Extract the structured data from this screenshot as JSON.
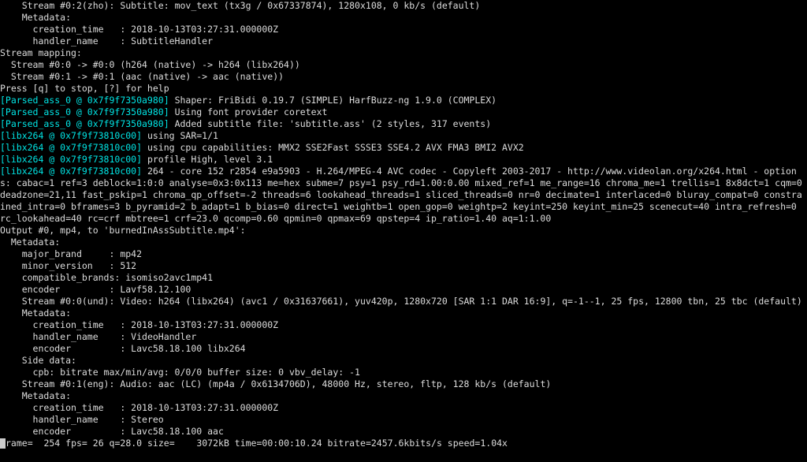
{
  "lines": [
    {
      "indent": "    ",
      "segments": [
        {
          "cls": "white",
          "text": "Stream #0:2(zho): Subtitle: mov_text (tx3g / 0x67337874), 1280x108, 0 kb/s (default)"
        }
      ]
    },
    {
      "indent": "    ",
      "segments": [
        {
          "cls": "white",
          "text": "Metadata:"
        }
      ]
    },
    {
      "indent": "      ",
      "segments": [
        {
          "cls": "white",
          "text": "creation_time   : 2018-10-13T03:27:31.000000Z"
        }
      ]
    },
    {
      "indent": "      ",
      "segments": [
        {
          "cls": "white",
          "text": "handler_name    : SubtitleHandler"
        }
      ]
    },
    {
      "indent": "",
      "segments": [
        {
          "cls": "white",
          "text": "Stream mapping:"
        }
      ]
    },
    {
      "indent": "  ",
      "segments": [
        {
          "cls": "white",
          "text": "Stream #0:0 -> #0:0 (h264 (native) -> h264 (libx264))"
        }
      ]
    },
    {
      "indent": "  ",
      "segments": [
        {
          "cls": "white",
          "text": "Stream #0:1 -> #0:1 (aac (native) -> aac (native))"
        }
      ]
    },
    {
      "indent": "",
      "segments": [
        {
          "cls": "white",
          "text": "Press [q] to stop, [?] for help"
        }
      ]
    },
    {
      "indent": "",
      "segments": [
        {
          "cls": "cyan",
          "text": "[Parsed_ass_0 @ 0x7f9f7350a980] "
        },
        {
          "cls": "white",
          "text": "Shaper: FriBidi 0.19.7 (SIMPLE) HarfBuzz-ng 1.9.0 (COMPLEX)"
        }
      ]
    },
    {
      "indent": "",
      "segments": [
        {
          "cls": "cyan",
          "text": "[Parsed_ass_0 @ 0x7f9f7350a980] "
        },
        {
          "cls": "white",
          "text": "Using font provider coretext"
        }
      ]
    },
    {
      "indent": "",
      "segments": [
        {
          "cls": "cyan",
          "text": "[Parsed_ass_0 @ 0x7f9f7350a980] "
        },
        {
          "cls": "white",
          "text": "Added subtitle file: 'subtitle.ass' (2 styles, 317 events)"
        }
      ]
    },
    {
      "indent": "",
      "segments": [
        {
          "cls": "cyan",
          "text": "[libx264 @ 0x7f9f73810c00] "
        },
        {
          "cls": "white",
          "text": "using SAR=1/1"
        }
      ]
    },
    {
      "indent": "",
      "segments": [
        {
          "cls": "cyan",
          "text": "[libx264 @ 0x7f9f73810c00] "
        },
        {
          "cls": "white",
          "text": "using cpu capabilities: MMX2 SSE2Fast SSSE3 SSE4.2 AVX FMA3 BMI2 AVX2"
        }
      ]
    },
    {
      "indent": "",
      "segments": [
        {
          "cls": "cyan",
          "text": "[libx264 @ 0x7f9f73810c00] "
        },
        {
          "cls": "white",
          "text": "profile High, level 3.1"
        }
      ]
    },
    {
      "indent": "",
      "segments": [
        {
          "cls": "cyan",
          "text": "[libx264 @ 0x7f9f73810c00] "
        },
        {
          "cls": "white",
          "text": "264 - core 152 r2854 e9a5903 - H.264/MPEG-4 AVC codec - Copyleft 2003-2017 - http://www.videolan.org/x264.html - options: cabac=1 ref=3 deblock=1:0:0 analyse=0x3:0x113 me=hex subme=7 psy=1 psy_rd=1.00:0.00 mixed_ref=1 me_range=16 chroma_me=1 trellis=1 8x8dct=1 cqm=0 deadzone=21,11 fast_pskip=1 chroma_qp_offset=-2 threads=6 lookahead_threads=1 sliced_threads=0 nr=0 decimate=1 interlaced=0 bluray_compat=0 constrained_intra=0 bframes=3 b_pyramid=2 b_adapt=1 b_bias=0 direct=1 weightb=1 open_gop=0 weightp=2 keyint=250 keyint_min=25 scenecut=40 intra_refresh=0 rc_lookahead=40 rc=crf mbtree=1 crf=23.0 qcomp=0.60 qpmin=0 qpmax=69 qpstep=4 ip_ratio=1.40 aq=1:1.00"
        }
      ]
    },
    {
      "indent": "",
      "segments": [
        {
          "cls": "white",
          "text": "Output #0, mp4, to 'burnedInAssSubtitle.mp4':"
        }
      ]
    },
    {
      "indent": "  ",
      "segments": [
        {
          "cls": "white",
          "text": "Metadata:"
        }
      ]
    },
    {
      "indent": "    ",
      "segments": [
        {
          "cls": "white",
          "text": "major_brand     : mp42"
        }
      ]
    },
    {
      "indent": "    ",
      "segments": [
        {
          "cls": "white",
          "text": "minor_version   : 512"
        }
      ]
    },
    {
      "indent": "    ",
      "segments": [
        {
          "cls": "white",
          "text": "compatible_brands: isomiso2avc1mp41"
        }
      ]
    },
    {
      "indent": "    ",
      "segments": [
        {
          "cls": "white",
          "text": "encoder         : Lavf58.12.100"
        }
      ]
    },
    {
      "indent": "    ",
      "segments": [
        {
          "cls": "white",
          "text": "Stream #0:0(und): Video: h264 (libx264) (avc1 / 0x31637661), yuv420p, 1280x720 [SAR 1:1 DAR 16:9], q=-1--1, 25 fps, 12800 tbn, 25 tbc (default)"
        }
      ]
    },
    {
      "indent": "    ",
      "segments": [
        {
          "cls": "white",
          "text": "Metadata:"
        }
      ]
    },
    {
      "indent": "      ",
      "segments": [
        {
          "cls": "white",
          "text": "creation_time   : 2018-10-13T03:27:31.000000Z"
        }
      ]
    },
    {
      "indent": "      ",
      "segments": [
        {
          "cls": "white",
          "text": "handler_name    : VideoHandler"
        }
      ]
    },
    {
      "indent": "      ",
      "segments": [
        {
          "cls": "white",
          "text": "encoder         : Lavc58.18.100 libx264"
        }
      ]
    },
    {
      "indent": "    ",
      "segments": [
        {
          "cls": "white",
          "text": "Side data:"
        }
      ]
    },
    {
      "indent": "      ",
      "segments": [
        {
          "cls": "white",
          "text": "cpb: bitrate max/min/avg: 0/0/0 buffer size: 0 vbv_delay: -1"
        }
      ]
    },
    {
      "indent": "    ",
      "segments": [
        {
          "cls": "white",
          "text": "Stream #0:1(eng): Audio: aac (LC) (mp4a / 0x6134706D), 48000 Hz, stereo, fltp, 128 kb/s (default)"
        }
      ]
    },
    {
      "indent": "    ",
      "segments": [
        {
          "cls": "white",
          "text": "Metadata:"
        }
      ]
    },
    {
      "indent": "      ",
      "segments": [
        {
          "cls": "white",
          "text": "creation_time   : 2018-10-13T03:27:31.000000Z"
        }
      ]
    },
    {
      "indent": "      ",
      "segments": [
        {
          "cls": "white",
          "text": "handler_name    : Stereo"
        }
      ]
    },
    {
      "indent": "      ",
      "segments": [
        {
          "cls": "white",
          "text": "encoder         : Lavc58.18.100 aac"
        }
      ]
    }
  ],
  "status_line": "rame=  254 fps= 26 q=28.0 size=    3072kB time=00:00:10.24 bitrate=2457.6kbits/s speed=1.04x"
}
